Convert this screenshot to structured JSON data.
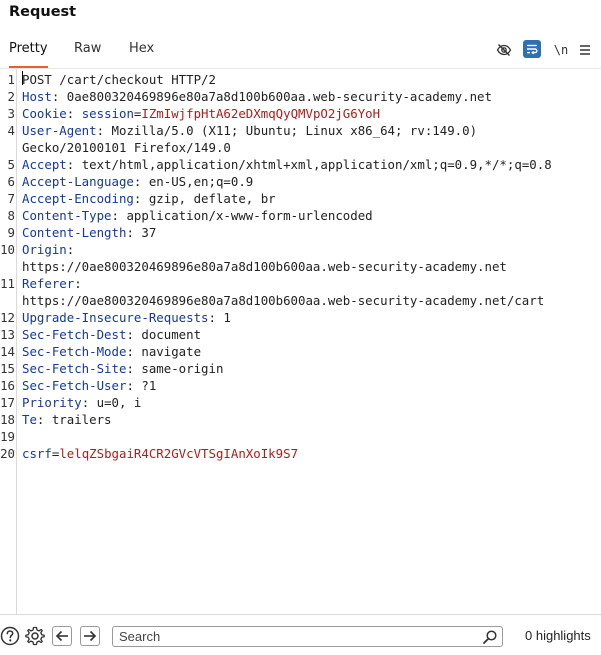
{
  "panel": {
    "title": "Request"
  },
  "tabs": [
    {
      "label": "Pretty",
      "active": true
    },
    {
      "label": "Raw",
      "active": false
    },
    {
      "label": "Hex",
      "active": false
    }
  ],
  "toolbar": {
    "icons": [
      "eye-slash-icon",
      "wrap-lines-icon",
      "newline-icon",
      "menu-icon"
    ],
    "newline_label": "\\n",
    "accent": "#2f6fb3"
  },
  "request": {
    "request_line": "POST /cart/checkout HTTP/2",
    "headers": [
      {
        "name": "Host",
        "value": "0ae800320469896e80a7a8d100b600aa.web-security-academy.net"
      },
      {
        "name": "Cookie",
        "cookie_name": "session",
        "cookie_value": "IZmIwjfpHtA62eDXmqQyQMVpO2jG6YoH"
      },
      {
        "name": "User-Agent",
        "value": "Mozilla/5.0 (X11; Ubuntu; Linux x86_64; rv:149.0)",
        "value_cont": "Gecko/20100101 Firefox/149.0"
      },
      {
        "name": "Accept",
        "value": "text/html,application/xhtml+xml,application/xml;q=0.9,*/*;q=0.8"
      },
      {
        "name": "Accept-Language",
        "value": "en-US,en;q=0.9"
      },
      {
        "name": "Accept-Encoding",
        "value": "gzip, deflate, br"
      },
      {
        "name": "Content-Type",
        "value": "application/x-www-form-urlencoded"
      },
      {
        "name": "Content-Length",
        "value": "37"
      },
      {
        "name": "Origin",
        "value_cont": "https://0ae800320469896e80a7a8d100b600aa.web-security-academy.net"
      },
      {
        "name": "Referer",
        "value_cont": "https://0ae800320469896e80a7a8d100b600aa.web-security-academy.net/cart"
      },
      {
        "name": "Upgrade-Insecure-Requests",
        "value": "1"
      },
      {
        "name": "Sec-Fetch-Dest",
        "value": "document"
      },
      {
        "name": "Sec-Fetch-Mode",
        "value": "navigate"
      },
      {
        "name": "Sec-Fetch-Site",
        "value": "same-origin"
      },
      {
        "name": "Sec-Fetch-User",
        "value": "?1"
      },
      {
        "name": "Priority",
        "value": "u=0, i"
      },
      {
        "name": "Te",
        "value": "trailers"
      }
    ],
    "body_param": {
      "name": "csrf",
      "value": "lelqZSbgaiR4CR2GVcVTSgIAnXoIk9S7"
    }
  },
  "line_numbers": [
    "1",
    "2",
    "3",
    "4",
    "",
    "5",
    "6",
    "7",
    "8",
    "9",
    "10",
    "",
    "11",
    "",
    "12",
    "13",
    "14",
    "15",
    "16",
    "17",
    "18",
    "19",
    "20"
  ],
  "bottom": {
    "search_placeholder": "Search",
    "highlights": "0 highlights"
  }
}
